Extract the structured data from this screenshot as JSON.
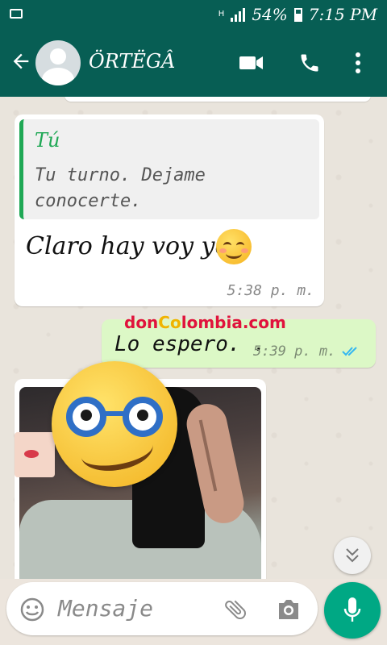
{
  "status_bar": {
    "network_badge": "H",
    "battery_percent": "54%",
    "time": "7:15 PM"
  },
  "header": {
    "contact_name": "ÖRTËGÂ",
    "icons": [
      "back-arrow-icon",
      "avatar",
      "video-call-icon",
      "phone-icon",
      "more-options-icon"
    ]
  },
  "messages": [
    {
      "direction": "incoming",
      "quoted": {
        "author": "Tú",
        "text": "Tu turno. Dejame conocerte."
      },
      "text": "Claro hay voy yo",
      "emoji": "smiling-face-icon",
      "time": "5:38 p. m."
    },
    {
      "direction": "outgoing",
      "text": "Lo espero. .",
      "time": "5:39 p. m.",
      "status": "read"
    },
    {
      "direction": "incoming",
      "type": "image",
      "overlay_emoji": "nerd-face-icon"
    }
  ],
  "watermark": {
    "part1": "don",
    "part2": "Co",
    "part3": "lombia.com"
  },
  "composer": {
    "placeholder": "Mensaje",
    "icons": [
      "emoji-icon",
      "attach-icon",
      "camera-icon",
      "mic-icon"
    ]
  },
  "colors": {
    "header": "#075e54",
    "outgoing_bubble": "#dcf8c6",
    "accent": "#1fa855",
    "fab": "#00a884",
    "read_ticks": "#34b7f1"
  }
}
